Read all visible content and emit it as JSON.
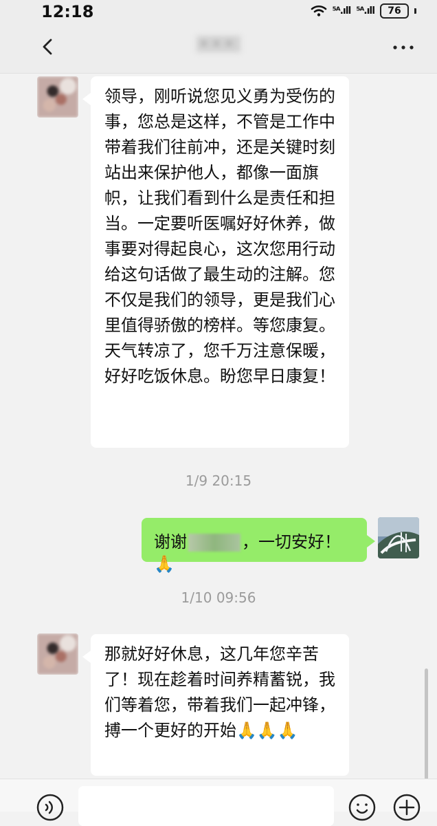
{
  "status_bar": {
    "time": "12:18",
    "signal_1": "⁵ᴬ.ıll",
    "signal_2": "⁵ᴬ.ıll",
    "battery": "76"
  },
  "chat": {
    "messages": [
      {
        "text": "领导，刚听说您见义勇为受伤的事，您总是这样，不管是工作中带着我们往前冲，还是关键时刻站出来保护他人，都像一面旗帜，让我们看到什么是责任和担当。一定要听医嘱好好休养，做事要对得起良心，这次您用行动给这句话做了最生动的注解。您不仅是我们的领导，更是我们心里值得骄傲的榜样。等您康复。天气转凉了，您千万注意保暖，好好吃饭休息。盼您早日康复！"
      },
      {
        "text_before": "谢谢",
        "text_after": "，一切安好！",
        "emoji": "🙏"
      },
      {
        "text": "那就好好休息，这几年您辛苦了！现在趁着时间养精蓄锐，我们等着您，带着我们一起冲锋，搏一个更好的开始🙏🙏🙏"
      }
    ],
    "timestamps": [
      "1/9 20:15",
      "1/10 09:56"
    ]
  },
  "colors": {
    "background": "#f2f2f2",
    "outgoing_bubble": "#95ec69",
    "incoming_bubble": "#ffffff"
  }
}
